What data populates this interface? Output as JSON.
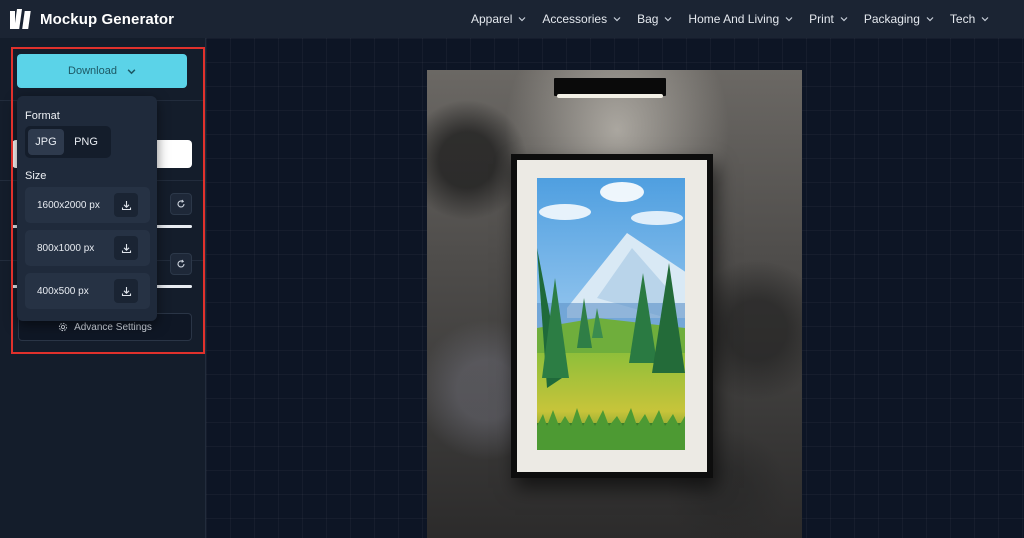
{
  "app": {
    "title": "Mockup Generator"
  },
  "nav": {
    "items": [
      {
        "label": "Apparel"
      },
      {
        "label": "Accessories"
      },
      {
        "label": "Bag"
      },
      {
        "label": "Home And Living"
      },
      {
        "label": "Print"
      },
      {
        "label": "Packaging"
      },
      {
        "label": "Tech"
      }
    ]
  },
  "sidebar": {
    "download_label": "Download",
    "advance_settings_label": "Advance Settings"
  },
  "download_menu": {
    "format_label": "Format",
    "formats": [
      "JPG",
      "PNG"
    ],
    "selected_format": "JPG",
    "size_label": "Size",
    "sizes": [
      "1600x2000 px",
      "800x1000 px",
      "400x500 px"
    ]
  },
  "colors": {
    "accent": "#5bd3e8",
    "highlight": "#e0312c",
    "header_bg": "#1b2433",
    "canvas_bg": "#0d1525"
  },
  "icons": {
    "download": "download-icon",
    "chevron": "chevron-down-icon",
    "reset": "refresh-icon",
    "settings": "gear-icon"
  }
}
